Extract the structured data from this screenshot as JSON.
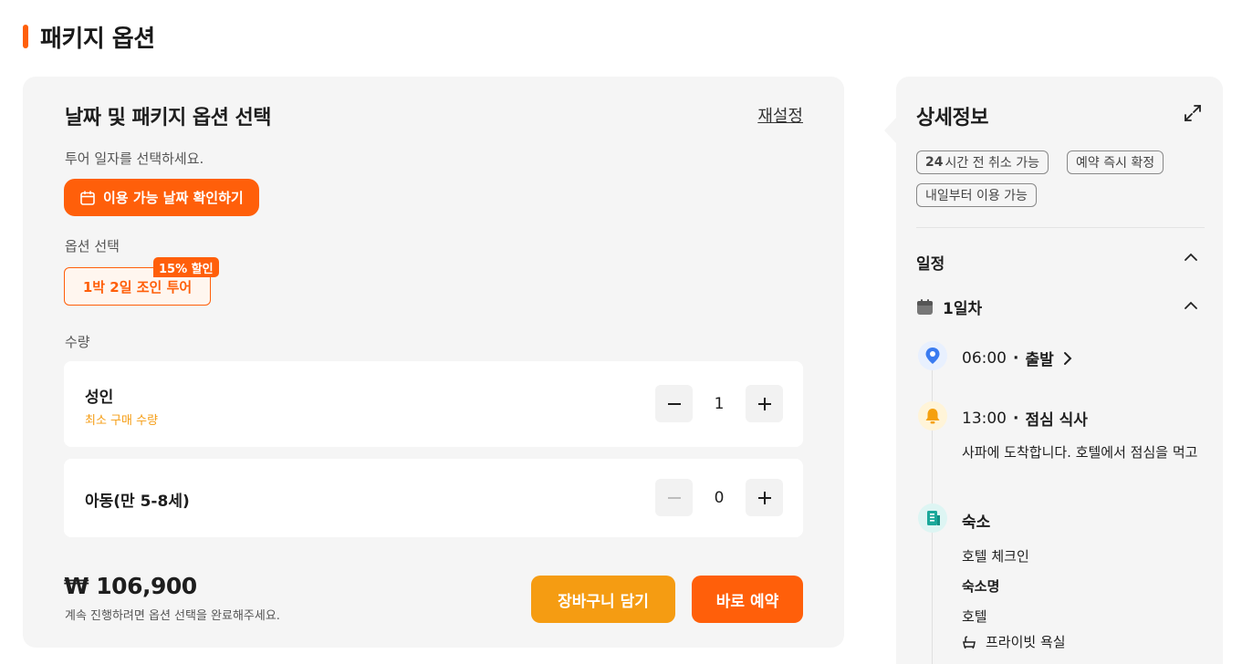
{
  "section_title": "패키지 옵션",
  "left_panel": {
    "heading": "날짜 및 패키지 옵션 선택",
    "reset_label": "재설정",
    "tour_hint": "투어 일자를 선택하세요.",
    "date_button_label": "이용 가능 날짜 확인하기",
    "date_button_icon": "calendar-icon",
    "option_label": "옵션 선택",
    "option": {
      "label": "1박 2일 조인 투어",
      "discount": "15% 할인"
    },
    "quantity_label": "수량",
    "quantities": [
      {
        "name": "성인",
        "note": "최소 구매 수량",
        "value": "1",
        "minus_disabled": false
      },
      {
        "name": "아동(만 5-8세)",
        "note": "",
        "value": "0",
        "minus_disabled": true
      }
    ],
    "price": "₩ 106,900",
    "price_note": "계속 진행하려면 옵션 선택을 완료해주세요.",
    "cart_button": "장바구니 담기",
    "book_button": "바로 예약"
  },
  "right_panel": {
    "title": "상세정보",
    "tags": [
      {
        "bold": "24",
        "text": "시간 전 취소 가능"
      },
      {
        "bold": "",
        "text": "예약 즉시 확정"
      },
      {
        "bold": "",
        "text": "내일부터 이용 가능"
      }
    ],
    "schedule_heading": "일정",
    "day_label": "1일차",
    "timeline": [
      {
        "icon": "location-pin-icon",
        "time": "06:00",
        "title": "출발"
      },
      {
        "icon": "bell-icon",
        "time": "13:00",
        "title": "점심 식사",
        "description": "사파에 도착합니다. 호텔에서 점심을 먹고"
      },
      {
        "icon": "hotel-icon",
        "time": "",
        "title": "숙소",
        "lines": [
          "호텔 체크인",
          "숙소명",
          "호텔"
        ],
        "amenity": "프라이빗 욕실"
      }
    ]
  },
  "colors": {
    "primary_orange": "#ff5f0a",
    "secondary_orange": "#f59c12",
    "panel_bg": "#f5f5f5"
  }
}
